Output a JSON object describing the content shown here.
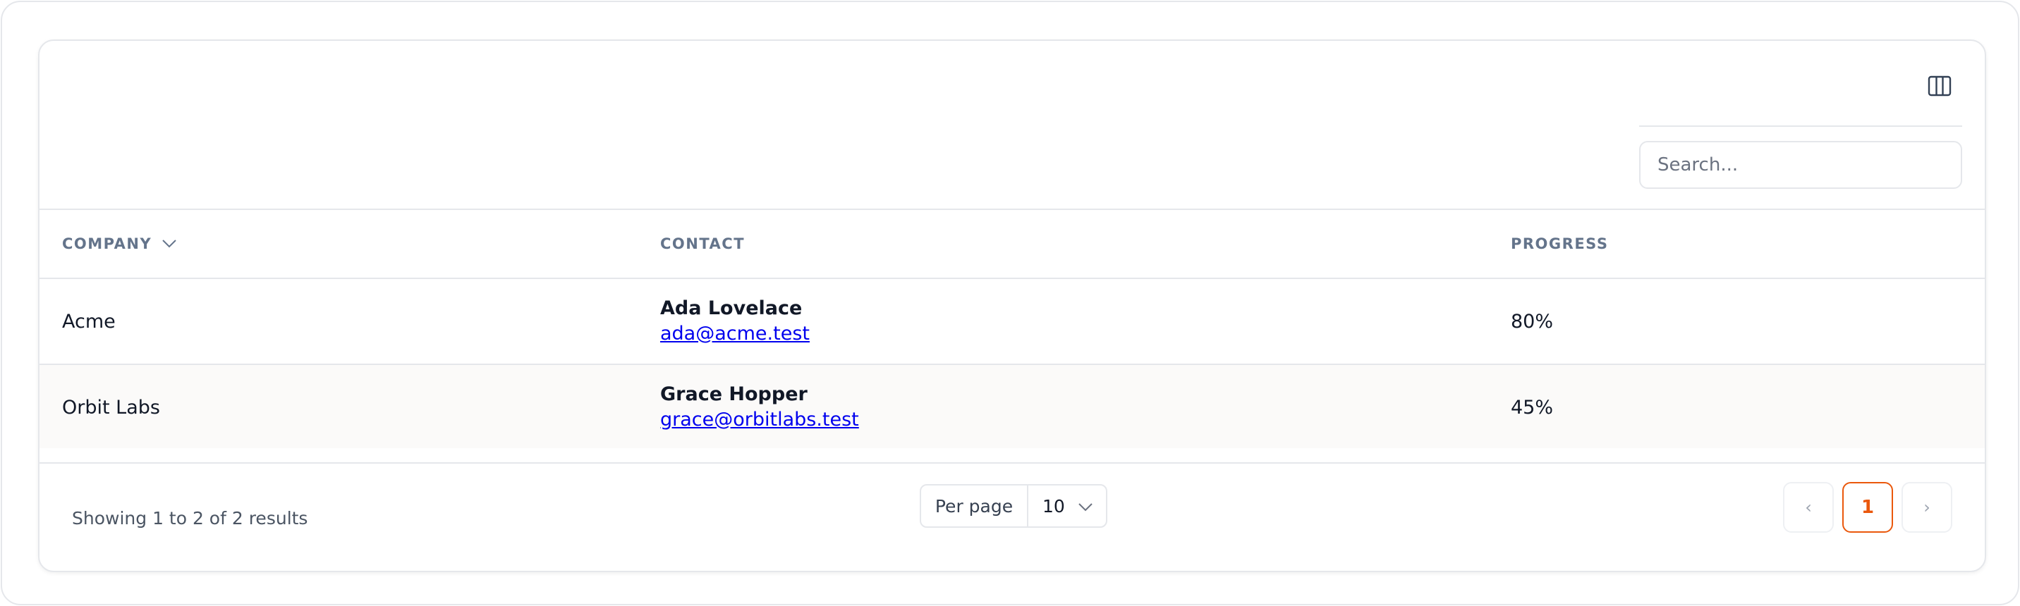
{
  "toolbar": {
    "column_toggle_icon": "columns-icon",
    "search_placeholder": "Search...",
    "search_value": ""
  },
  "table": {
    "columns": [
      {
        "label": "COMPANY",
        "sortable": true,
        "sort_icon": "chevron-down-icon"
      },
      {
        "label": "CONTACT"
      },
      {
        "label": "PROGRESS"
      }
    ],
    "rows": [
      {
        "company": "Acme",
        "contact_name": "Ada Lovelace",
        "contact_email": "ada@acme.test",
        "progress": "80%"
      },
      {
        "company": "Orbit Labs",
        "contact_name": "Grace Hopper",
        "contact_email": "grace@orbitlabs.test",
        "progress": "45%"
      }
    ]
  },
  "footer": {
    "summary": "Showing 1 to 2 of 2 results",
    "per_page_label": "Per page",
    "per_page_value": "10",
    "pagination": {
      "prev": "‹",
      "current": "1",
      "next": "›"
    }
  },
  "colors": {
    "accent": "#ea580c",
    "link": "#0000ee",
    "header_text": "#64748b",
    "border": "#e5e7eb",
    "striped_row": "#fbfaf9"
  }
}
